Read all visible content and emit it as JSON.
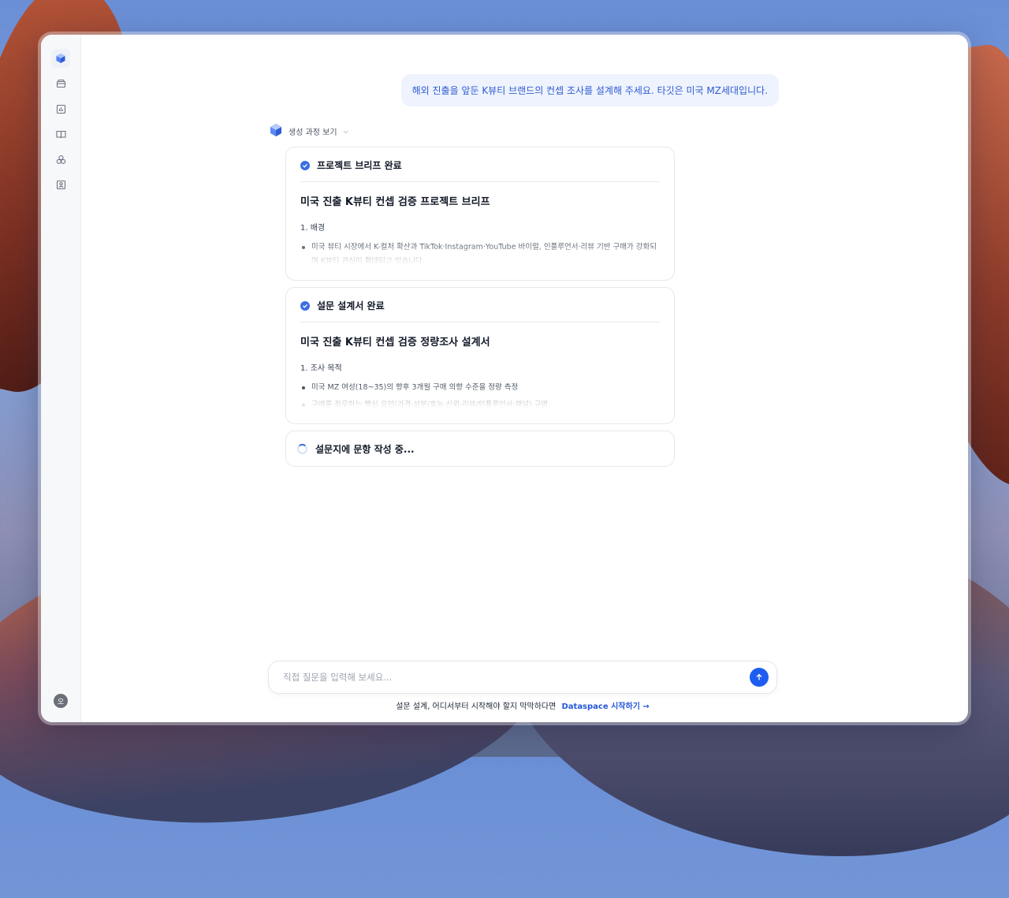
{
  "user_message": "해외 진출을 앞둔 K뷰티 브랜드의 컨셉 조사를 설계해 주세요. 타깃은 미국 MZ세대입니다.",
  "process_toggle": {
    "label": "생성 과정 보기"
  },
  "cards": [
    {
      "status": "프로젝트 브리프 완료",
      "doc_title": "미국 진출 K뷰티 컨셉 검증 프로젝트 브리프",
      "section": "1. 배경",
      "bullets": [
        "미국 뷰티 시장에서 K-컬처 확산과 TikTok·Instagram·YouTube 바이럴, 인플루언서·리뷰 기반 구매가 강화되며 K뷰티 관심이 확대되고 있습니다."
      ]
    },
    {
      "status": "설문 설계서 완료",
      "doc_title": "미국 진출 K뷰티 컨셉 검증 정량조사 설계서",
      "section": "1. 조사 목적",
      "bullets": [
        "미국 MZ 여성(18~35)의 향후 3개월 구매 의향 수준을 정량 측정",
        "구매를 좌우하는 핵심 요인(가격·성분/효능·신뢰·리뷰/인플루언서·채널) 규명"
      ]
    }
  ],
  "loading_card": {
    "status": "설문지에 문항 작성 중..."
  },
  "composer": {
    "placeholder": "직접 질문을 입력해 보세요...",
    "value": ""
  },
  "footer": {
    "text": "설문 설계, 어디서부터 시작해야 할지 막막하다면",
    "link": "Dataspace 시작하기 →"
  },
  "user": {
    "avatar_initial": "오"
  },
  "icons": {
    "sidebar": [
      "logo-icon",
      "archive-icon",
      "chart-icon",
      "book-icon",
      "shapes-icon",
      "contacts-icon"
    ],
    "send": "arrow-up-icon"
  },
  "colors": {
    "accent": "#1e5df2",
    "bubble_bg": "#eef3fd",
    "bubble_text": "#2f5bd3"
  }
}
